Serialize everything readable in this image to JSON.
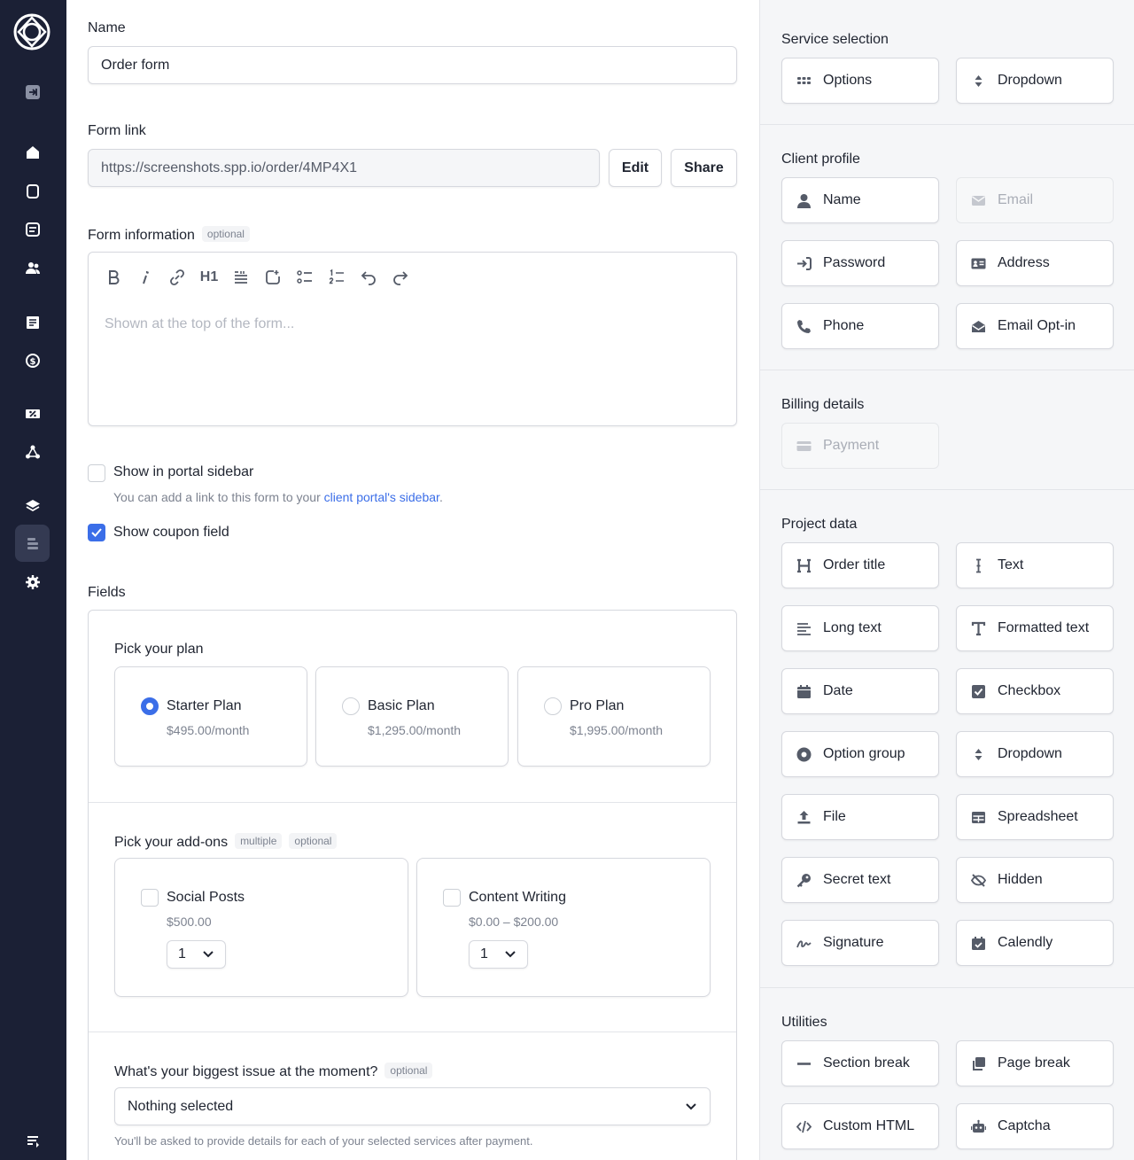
{
  "form": {
    "name_label": "Name",
    "name_value": "Order form",
    "link_label": "Form link",
    "link_value": "https://screenshots.spp.io/order/4MP4X1",
    "edit_label": "Edit",
    "share_label": "Share",
    "info_label": "Form information",
    "info_tag": "optional",
    "info_placeholder": "Shown at the top of the form...",
    "toolbar": {
      "h1": "H1"
    },
    "sidebar_check_label": "Show in portal sidebar",
    "sidebar_hint_pre": "You can add a link to this form to your ",
    "sidebar_hint_link": "client portal's sidebar",
    "sidebar_hint_post": ".",
    "coupon_label": "Show coupon field",
    "coupon_checked": true,
    "fields_label": "Fields"
  },
  "plans": {
    "title": "Pick your plan",
    "items": [
      {
        "name": "Starter Plan",
        "price": "$495.00/month",
        "selected": true
      },
      {
        "name": "Basic Plan",
        "price": "$1,295.00/month",
        "selected": false
      },
      {
        "name": "Pro Plan",
        "price": "$1,995.00/month",
        "selected": false
      }
    ]
  },
  "addons": {
    "title": "Pick your add-ons",
    "tag1": "multiple",
    "tag2": "optional",
    "items": [
      {
        "name": "Social Posts",
        "price": "$500.00",
        "qty": "1"
      },
      {
        "name": "Content Writing",
        "price": "$0.00 – $200.00",
        "qty": "1"
      }
    ]
  },
  "issue": {
    "title": "What's your biggest issue at the moment?",
    "tag": "optional",
    "value": "Nothing selected",
    "hint": "You'll be asked to provide details for each of your selected services after payment."
  },
  "panel": {
    "service_selection": {
      "title": "Service selection",
      "items": [
        "Options",
        "Dropdown"
      ]
    },
    "client_profile": {
      "title": "Client profile",
      "items": [
        "Name",
        "Email",
        "Password",
        "Address",
        "Phone",
        "Email Opt-in"
      ]
    },
    "billing": {
      "title": "Billing details",
      "items": [
        "Payment"
      ]
    },
    "project_data": {
      "title": "Project data",
      "items": [
        "Order title",
        "Text",
        "Long text",
        "Formatted text",
        "Date",
        "Checkbox",
        "Option group",
        "Dropdown",
        "File",
        "Spreadsheet",
        "Secret text",
        "Hidden",
        "Signature",
        "Calendly"
      ]
    },
    "utilities": {
      "title": "Utilities",
      "items": [
        "Section break",
        "Page break",
        "Custom HTML",
        "Captcha"
      ]
    }
  },
  "colors": {
    "sidebar": "#1b2035",
    "accent": "#3b6ee8",
    "panel_bg": "#f5f6f8"
  }
}
